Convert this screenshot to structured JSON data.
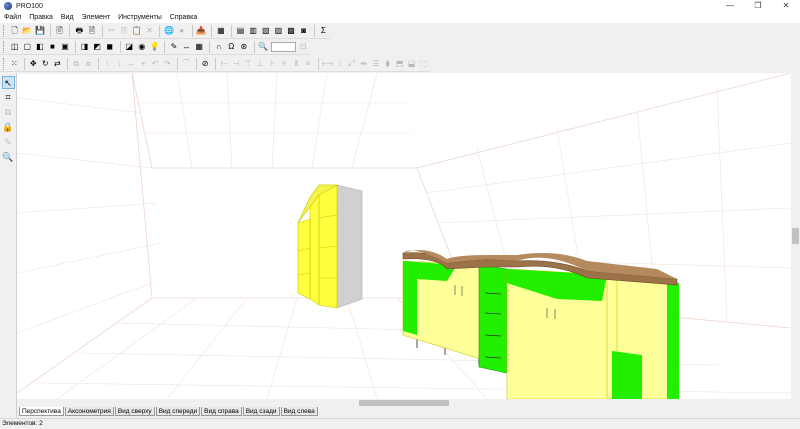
{
  "window": {
    "title": "PRO100",
    "minimize": "—",
    "maximize": "❐",
    "close": "✕"
  },
  "menu": [
    "Файл",
    "Правка",
    "Вид",
    "Элемент",
    "Инструменты",
    "Справка"
  ],
  "toolbar1": [
    {
      "name": "new-file-icon",
      "g": "🗋",
      "dis": false
    },
    {
      "name": "open-folder-icon",
      "g": "📂",
      "dis": false
    },
    {
      "name": "save-icon",
      "g": "💾",
      "dis": false
    },
    {
      "sep": true
    },
    {
      "name": "print-preview-icon",
      "g": "🖹",
      "dis": false
    },
    {
      "sep": true
    },
    {
      "name": "print-icon",
      "g": "🖶",
      "dis": false
    },
    {
      "name": "page-setup-icon",
      "g": "🗎",
      "dis": false
    },
    {
      "sep": true
    },
    {
      "name": "cut-icon",
      "g": "✂",
      "dis": true
    },
    {
      "name": "copy-icon",
      "g": "⎘",
      "dis": true
    },
    {
      "name": "paste-icon",
      "g": "📋",
      "dis": true
    },
    {
      "name": "delete-icon",
      "g": "✕",
      "dis": true
    },
    {
      "sep": true
    },
    {
      "name": "globe-icon",
      "g": "🌐",
      "dis": false
    },
    {
      "name": "sphere-icon",
      "g": "●",
      "dis": true
    },
    {
      "sep": true
    },
    {
      "name": "library-icon",
      "g": "📥",
      "dis": true
    },
    {
      "sep": true
    },
    {
      "name": "calculator-icon",
      "g": "▦",
      "dis": false
    },
    {
      "sep": true
    },
    {
      "name": "report-icon",
      "g": "▤",
      "dis": false
    },
    {
      "name": "list-icon",
      "g": "▥",
      "dis": false
    },
    {
      "name": "cut-list-icon",
      "g": "▧",
      "dis": false
    },
    {
      "name": "export-icon",
      "g": "▨",
      "dis": false
    },
    {
      "name": "order-icon",
      "g": "▩",
      "dis": false
    },
    {
      "name": "price-icon",
      "g": "◙",
      "dis": false
    },
    {
      "sep": true
    },
    {
      "name": "sigma-icon",
      "g": "Σ",
      "dis": false
    }
  ],
  "toolbar2": [
    {
      "name": "box-view-icon",
      "g": "◫",
      "dis": false
    },
    {
      "name": "wireframe-icon",
      "g": "▢",
      "dis": false
    },
    {
      "name": "shaded-icon",
      "g": "◧",
      "dis": false
    },
    {
      "name": "solid-icon",
      "g": "■",
      "dis": false
    },
    {
      "name": "texture-icon",
      "g": "▣",
      "dis": false
    },
    {
      "sep": true
    },
    {
      "name": "left-panel-icon",
      "g": "◨",
      "dis": false
    },
    {
      "name": "right-panel-icon",
      "g": "◩",
      "dis": false
    },
    {
      "name": "cube-icon",
      "g": "◼",
      "dis": false
    },
    {
      "sep": true
    },
    {
      "name": "shadow-icon",
      "g": "◪",
      "dis": false
    },
    {
      "name": "light-icon",
      "g": "◉",
      "dis": false
    },
    {
      "name": "bulb-icon",
      "g": "💡",
      "dis": false
    },
    {
      "sep": true
    },
    {
      "name": "brush-icon",
      "g": "✎",
      "dis": false
    },
    {
      "name": "dimension-icon",
      "g": "↔",
      "dis": false
    },
    {
      "name": "grid-icon",
      "g": "▦",
      "dis": false
    },
    {
      "sep": true
    },
    {
      "name": "magnet-icon",
      "g": "∩",
      "dis": false
    },
    {
      "name": "snap-icon",
      "g": "Ω",
      "dis": false
    },
    {
      "name": "lifebuoy-icon",
      "g": "⊛",
      "dis": false
    },
    {
      "sep": true
    },
    {
      "name": "zoom-icon",
      "g": "🔍",
      "dis": true
    },
    {
      "zoom": true
    },
    {
      "name": "zoom-reset-icon",
      "g": "⊡",
      "dis": true
    }
  ],
  "toolbar3": [
    {
      "name": "grid-dots-icon",
      "g": "⁙",
      "dis": false
    },
    {
      "sep": true
    },
    {
      "name": "move-icon",
      "g": "✥",
      "dis": false
    },
    {
      "name": "rotate-icon",
      "g": "↻",
      "dis": false
    },
    {
      "name": "mirror-icon",
      "g": "⇄",
      "dis": false
    },
    {
      "sep": true
    },
    {
      "name": "group-icon",
      "g": "⧉",
      "dis": true
    },
    {
      "name": "ungroup-icon",
      "g": "⧈",
      "dis": true
    },
    {
      "sep": true
    },
    {
      "name": "up-icon",
      "g": "↑",
      "dis": true
    },
    {
      "name": "down-icon",
      "g": "↓",
      "dis": true
    },
    {
      "name": "left-right-icon",
      "g": "↔",
      "dis": true
    },
    {
      "name": "plus-icon",
      "g": "+",
      "dis": true
    },
    {
      "name": "rotate-left-icon",
      "g": "↶",
      "dis": true
    },
    {
      "name": "rotate-right-icon",
      "g": "↷",
      "dis": true
    },
    {
      "sep": true
    },
    {
      "name": "arc-icon",
      "g": "⌒",
      "dis": true
    },
    {
      "sep": true
    },
    {
      "name": "stop-icon",
      "g": "⊘",
      "dis": false
    },
    {
      "sep": true
    },
    {
      "name": "align-left-icon",
      "g": "⊢",
      "dis": true
    },
    {
      "name": "align-center-icon",
      "g": "⊣",
      "dis": true
    },
    {
      "name": "align-right-icon",
      "g": "⊤",
      "dis": true
    },
    {
      "name": "align-top-icon",
      "g": "⊥",
      "dis": true
    },
    {
      "name": "align-middle-icon",
      "g": "⊦",
      "dis": true
    },
    {
      "name": "align-bottom-icon",
      "g": "⊧",
      "dis": true
    },
    {
      "name": "distribute-h-icon",
      "g": "⫴",
      "dis": true
    },
    {
      "name": "distribute-v-icon",
      "g": "≡",
      "dis": true
    },
    {
      "sep": true
    },
    {
      "name": "size-width-icon",
      "g": "⟷",
      "dis": true
    },
    {
      "name": "size-height-icon",
      "g": "↕",
      "dis": true
    },
    {
      "name": "size-depth-icon",
      "g": "⤢",
      "dis": true
    },
    {
      "name": "spacing-icon",
      "g": "⇹",
      "dis": true
    },
    {
      "name": "stack-icon",
      "g": "☰",
      "dis": true
    },
    {
      "name": "arrange-icon",
      "g": "⧫",
      "dis": true
    },
    {
      "name": "order-front-icon",
      "g": "⬒",
      "dis": true
    },
    {
      "name": "order-back-icon",
      "g": "⬓",
      "dis": true
    },
    {
      "name": "snap-grid-icon",
      "g": "⬚",
      "dis": true
    }
  ],
  "sidebar": [
    {
      "name": "select-tool-icon",
      "g": "↖",
      "active": true,
      "dis": false
    },
    {
      "name": "walls-tool-icon",
      "g": "⌗",
      "active": false,
      "dis": false
    },
    {
      "name": "copy-tool-icon",
      "g": "⧉",
      "active": false,
      "dis": true
    },
    {
      "name": "lock-tool-icon",
      "g": "🔒",
      "active": false,
      "dis": true
    },
    {
      "name": "edit-tool-icon",
      "g": "✎",
      "active": false,
      "dis": true
    },
    {
      "name": "zoom-tool-icon",
      "g": "🔍",
      "active": false,
      "dis": true
    }
  ],
  "tabs": [
    "Перспектива",
    "Аксонометрия",
    "Вид сверху",
    "Вид спереди",
    "Вид справа",
    "Вид сзади",
    "Вид слева"
  ],
  "active_tab": 0,
  "status": "Элементов: 2",
  "colors": {
    "yellow": "#ffff40",
    "light_yellow": "#ffff99",
    "green": "#22ee00",
    "gray": "#d0d0d0",
    "wood": "#9c7248",
    "grid": "#ecd6cb"
  }
}
